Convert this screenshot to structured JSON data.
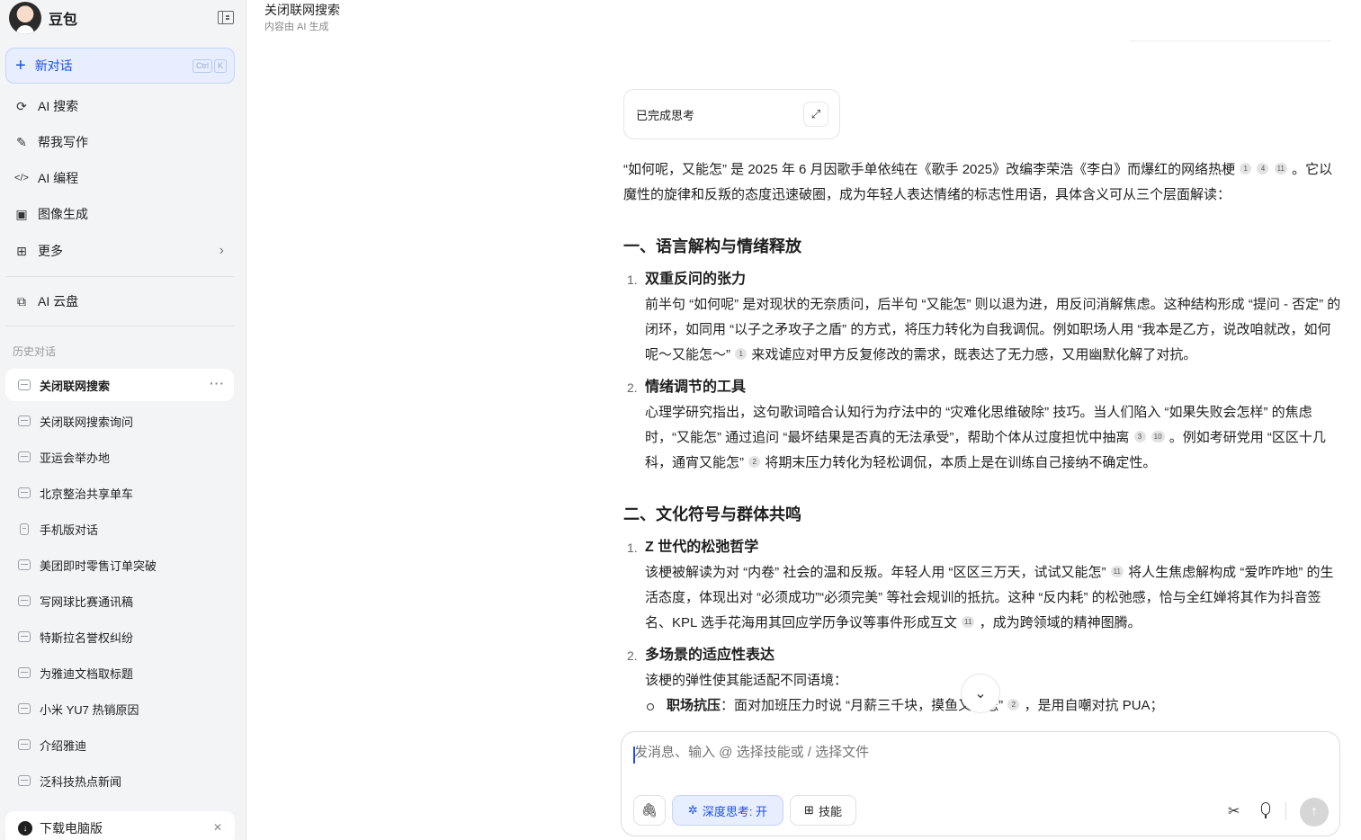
{
  "sidebar": {
    "app_name": "豆包",
    "new_chat": {
      "label": "新对话",
      "shortcut": [
        "Ctrl",
        "K"
      ]
    },
    "nav": [
      {
        "label": "AI 搜索",
        "icon": "search-refresh-icon"
      },
      {
        "label": "帮我写作",
        "icon": "pen-icon"
      },
      {
        "label": "AI 编程",
        "icon": "code-icon"
      },
      {
        "label": "图像生成",
        "icon": "image-icon"
      },
      {
        "label": "更多",
        "icon": "grid-icon"
      }
    ],
    "cloud": {
      "label": "AI 云盘",
      "icon": "cloud-drive-icon"
    },
    "history_title": "历史对话",
    "history": [
      {
        "label": "关闭联网搜索",
        "active": true
      },
      {
        "label": "关闭联网搜索询问"
      },
      {
        "label": "亚运会举办地"
      },
      {
        "label": "北京整治共享单车"
      },
      {
        "label": "手机版对话"
      },
      {
        "label": "美团即时零售订单突破"
      },
      {
        "label": "写网球比赛通讯稿"
      },
      {
        "label": "特斯拉名誉权纠纷"
      },
      {
        "label": "为雅迪文档取标题"
      },
      {
        "label": "小米 YU7 热销原因"
      },
      {
        "label": "介绍雅迪"
      },
      {
        "label": "泛科技热点新闻"
      }
    ],
    "download": {
      "label": "下载电脑版"
    }
  },
  "header": {
    "title": "关闭联网搜索",
    "subtitle": "内容由 AI 生成"
  },
  "thinking": {
    "label": "已完成思考"
  },
  "answer": {
    "intro_1": "“如何呢，又能怎” 是 2025 年 6 月因歌手单依纯在《歌手 2025》改编李荣浩《李白》而爆红的网络热梗",
    "intro_cites": [
      "1",
      "4",
      "11"
    ],
    "intro_2": "。它以魔性的旋律和反叛的态度迅速破圈，成为年轻人表达情绪的标志性用语，具体含义可从三个层面解读：",
    "section1": {
      "heading": "一、语言解构与情绪释放",
      "item1": {
        "num": "1.",
        "title": "双重反问的张力",
        "text_a": "前半句 “如何呢” 是对现状的无奈质问，后半句 “又能怎” 则以退为进，用反问消解焦虑。这种结构形成 “提问 - 否定” 的闭环，如同用 “以子之矛攻子之盾” 的方式，将压力转化为自我调侃。例如职场人用 “我本是乙方，说改咱就改，如何呢～又能怎～”",
        "cite_a": "1",
        "text_b": "来戏谑应对甲方反复修改的需求，既表达了无力感，又用幽默化解了对抗。"
      },
      "item2": {
        "num": "2.",
        "title": "情绪调节的工具",
        "text_a": "心理学研究指出，这句歌词暗合认知行为疗法中的 “灾难化思维破除” 技巧。当人们陷入 “如果失败会怎样” 的焦虑时，“又能怎” 通过追问 “最坏结果是否真的无法承受”，帮助个体从过度担忧中抽离",
        "cites_a": [
          "3",
          "10"
        ],
        "text_b": "。例如考研党用 “区区十几科，通宵又能怎”",
        "cite_b": "2",
        "text_c": "将期末压力转化为轻松调侃，本质上是在训练自己接纳不确定性。"
      }
    },
    "section2": {
      "heading": "二、文化符号与群体共鸣",
      "item1": {
        "num": "1.",
        "title": "Z 世代的松弛哲学",
        "text_a": "该梗被解读为对 “内卷” 社会的温和反叛。年轻人用 “区区三万天，试试又能怎”",
        "cite_a": "11",
        "text_b": "将人生焦虑解构成 “爱咋咋地” 的生活态度，体现出对 “必须成功”“必须完美” 等社会规训的抵抗。这种 “反内耗” 的松弛感，恰与全红婵将其作为抖音签名、KPL 选手花海用其回应学历争议等事件形成互文",
        "cite_b": "11",
        "text_c": "，成为跨领域的精神图腾。"
      },
      "item2": {
        "num": "2.",
        "title": "多场景的适应性表达",
        "text": "该梗的弹性使其能适配不同语境：",
        "bullet": {
          "bold": "职场抗压",
          "text": "：面对加班压力时说 “月薪三千块，摸鱼又能怎”",
          "cite": "2",
          "tail": "，是用自嘲对抗 PUA；"
        }
      }
    }
  },
  "composer": {
    "placeholder": "发消息、输入 @ 选择技能或 / 选择文件",
    "deep_think": "深度思考: 开",
    "skill": "技能"
  }
}
